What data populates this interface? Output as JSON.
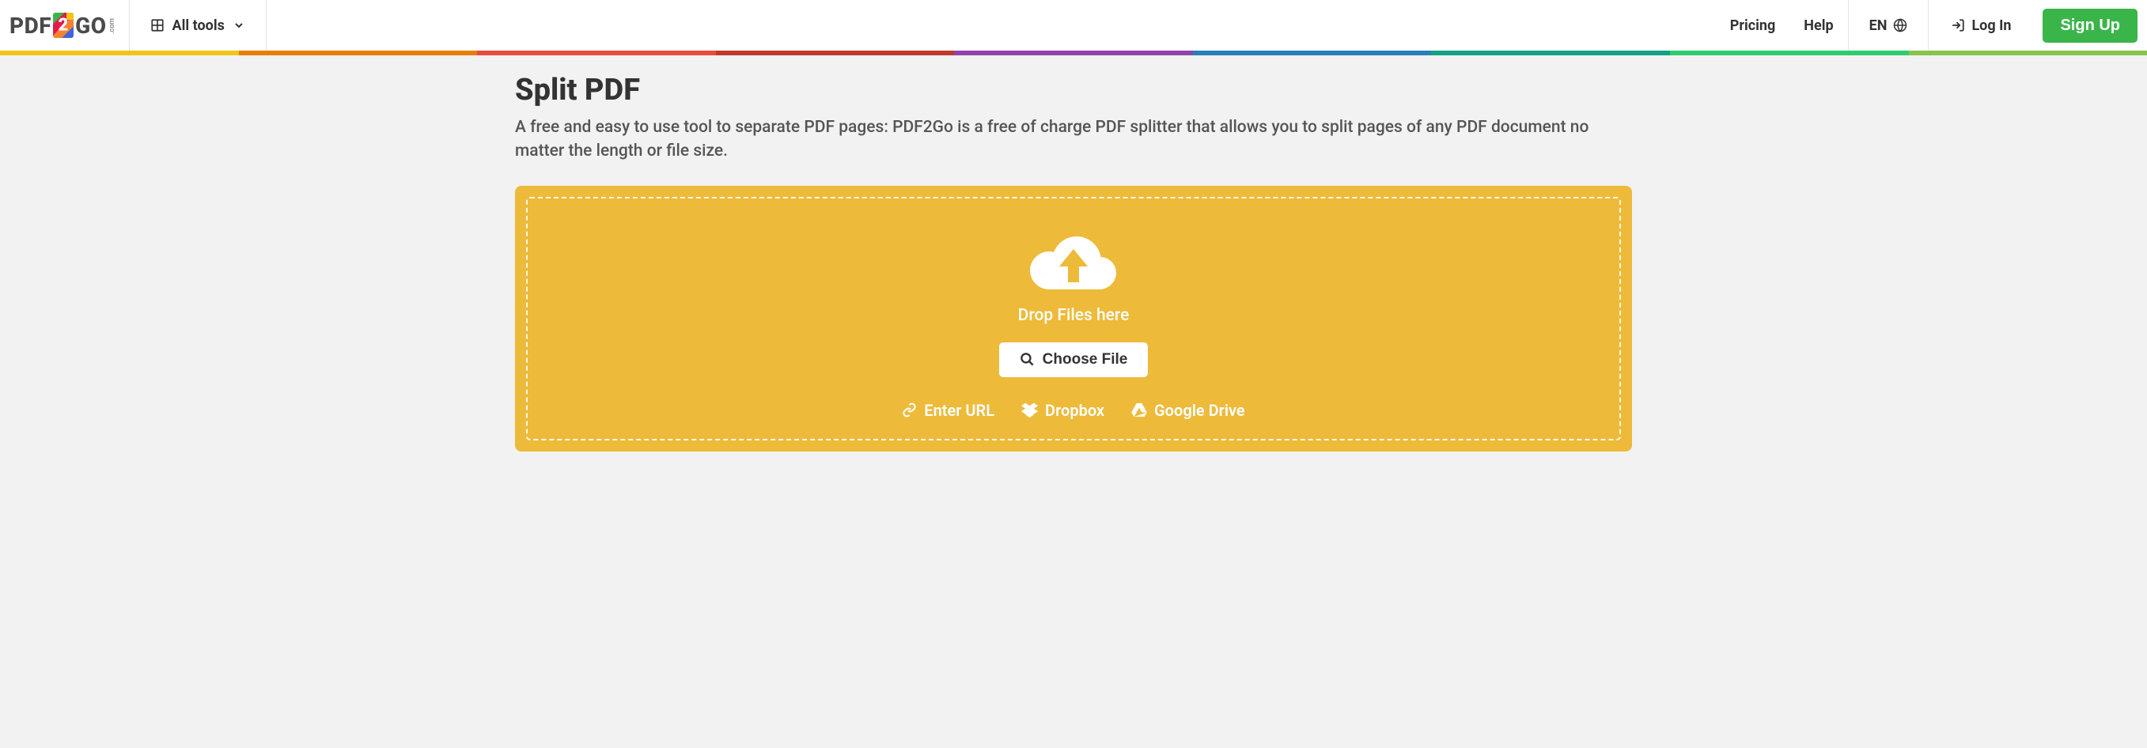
{
  "header": {
    "logo_pdf": "PDF",
    "logo_two": "2",
    "logo_go": "GO",
    "logo_com": ".com",
    "all_tools": "All tools",
    "pricing": "Pricing",
    "help": "Help",
    "language": "EN",
    "login": "Log In",
    "signup": "Sign Up"
  },
  "page": {
    "title": "Split PDF",
    "description": "A free and easy to use tool to separate PDF pages: PDF2Go is a free of charge PDF splitter that allows you to split pages of any PDF document no matter the length or file size."
  },
  "dropzone": {
    "drop_text": "Drop Files here",
    "choose_file": "Choose File",
    "enter_url": "Enter URL",
    "dropbox": "Dropbox",
    "google_drive": "Google Drive"
  }
}
